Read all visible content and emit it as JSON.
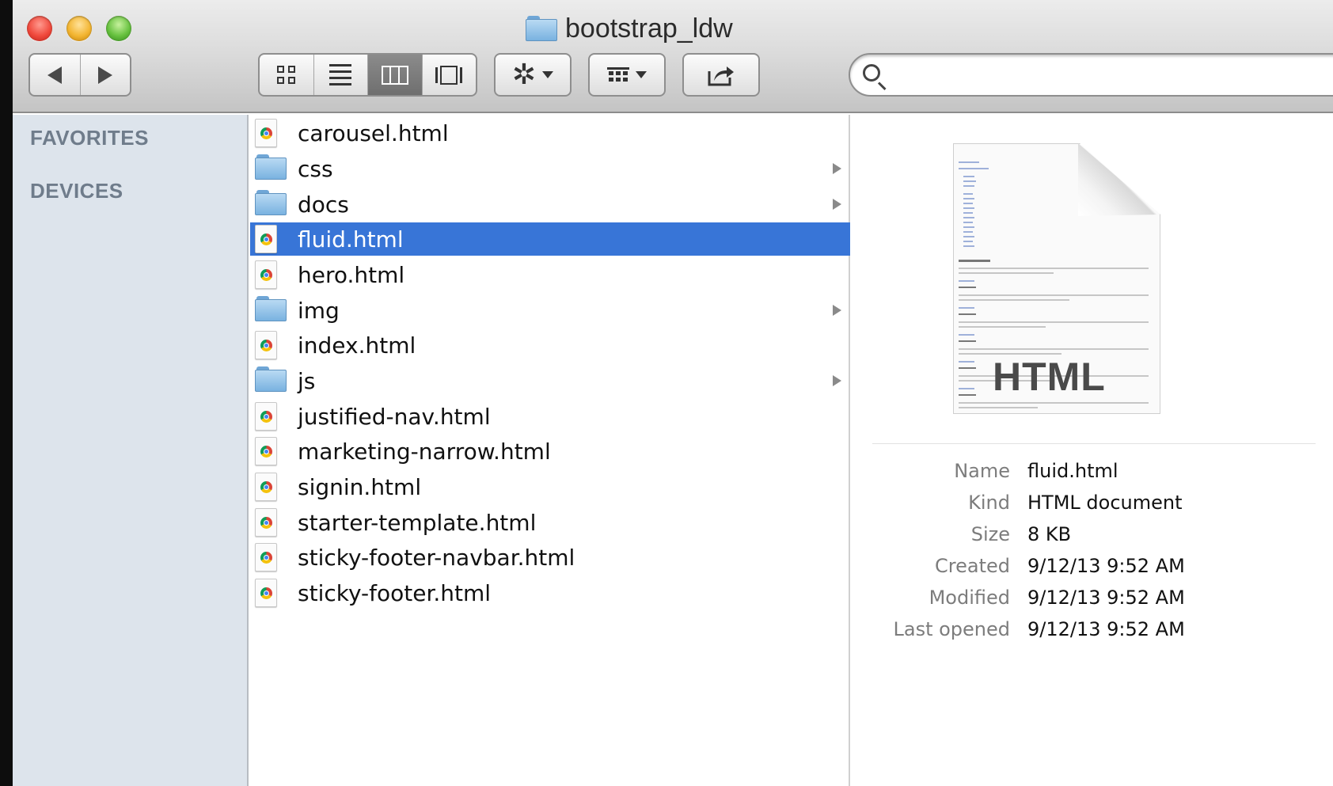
{
  "window": {
    "title": "bootstrap_ldw"
  },
  "toolbar": {
    "nav": {
      "back_icon": "back-arrow-icon",
      "forward_icon": "forward-arrow-icon"
    },
    "view_modes": [
      "icon-view",
      "list-view",
      "column-view",
      "coverflow-view"
    ],
    "active_view": "column-view",
    "action_icon": "gear-icon",
    "arrange_icon": "arrange-grid-icon",
    "share_icon": "share-icon",
    "search": {
      "placeholder": "",
      "value": ""
    }
  },
  "sidebar": {
    "sections": [
      "FAVORITES",
      "DEVICES"
    ]
  },
  "files": [
    {
      "name": "carousel.html",
      "type": "html"
    },
    {
      "name": "css",
      "type": "folder"
    },
    {
      "name": "docs",
      "type": "folder"
    },
    {
      "name": "fluid.html",
      "type": "html",
      "selected": true
    },
    {
      "name": "hero.html",
      "type": "html"
    },
    {
      "name": "img",
      "type": "folder"
    },
    {
      "name": "index.html",
      "type": "html"
    },
    {
      "name": "js",
      "type": "folder"
    },
    {
      "name": "justified-nav.html",
      "type": "html"
    },
    {
      "name": "marketing-narrow.html",
      "type": "html"
    },
    {
      "name": "signin.html",
      "type": "html"
    },
    {
      "name": "starter-template.html",
      "type": "html"
    },
    {
      "name": "sticky-footer-navbar.html",
      "type": "html"
    },
    {
      "name": "sticky-footer.html",
      "type": "html"
    }
  ],
  "preview": {
    "thumbnail_label": "HTML",
    "info": [
      {
        "key": "Name",
        "value": "fluid.html"
      },
      {
        "key": "Kind",
        "value": "HTML document"
      },
      {
        "key": "Size",
        "value": "8 KB"
      },
      {
        "key": "Created",
        "value": "9/12/13 9:52 AM"
      },
      {
        "key": "Modified",
        "value": "9/12/13 9:52 AM"
      },
      {
        "key": "Last opened",
        "value": "9/12/13 9:52 AM"
      }
    ]
  },
  "colors": {
    "selection": "#3875d7",
    "sidebar_bg": "#dde4ec",
    "sidebar_heading": "#6f7c8b"
  }
}
